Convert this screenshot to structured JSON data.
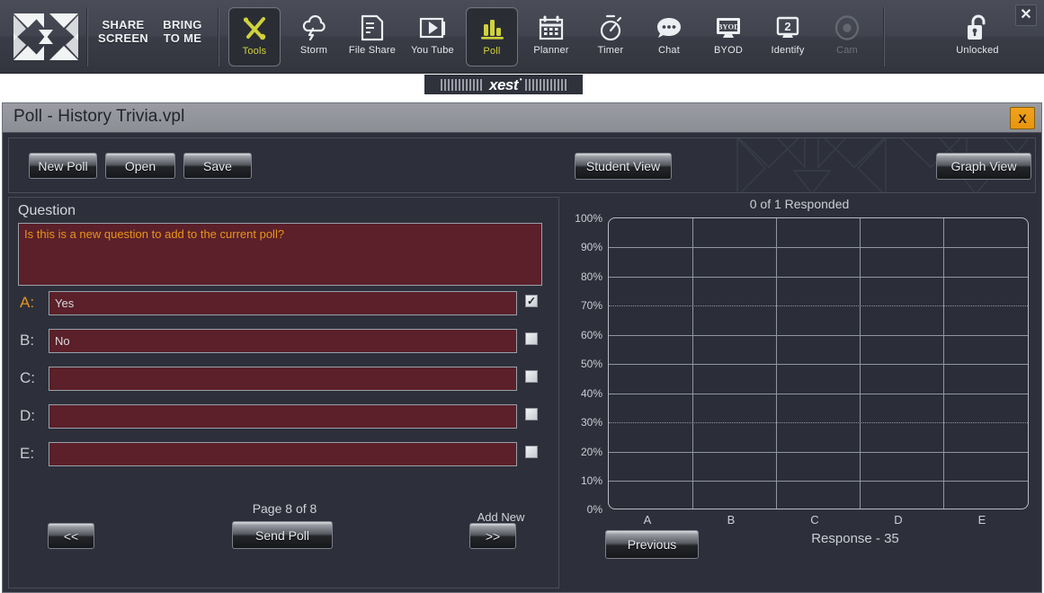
{
  "toolbar": {
    "logo_icon": "xest-x-logo",
    "text_buttons": [
      {
        "name": "share-screen",
        "line1": "SHARE",
        "line2": "SCREEN"
      },
      {
        "name": "bring-to-me",
        "line1": "BRING",
        "line2": "TO ME"
      }
    ],
    "items": [
      {
        "label": "Tools",
        "icon": "tools-wrench-screwdriver-icon",
        "selected": true,
        "dimmed": false
      },
      {
        "label": "Storm",
        "icon": "cloud-lightning-icon",
        "selected": false,
        "dimmed": false
      },
      {
        "label": "File Share",
        "icon": "document-icon",
        "selected": false,
        "dimmed": false
      },
      {
        "label": "You Tube",
        "icon": "video-play-icon",
        "selected": false,
        "dimmed": false
      },
      {
        "label": "Poll",
        "icon": "bar-chart-icon",
        "selected": true,
        "dimmed": false
      },
      {
        "label": "Planner",
        "icon": "calendar-icon",
        "selected": false,
        "dimmed": false
      },
      {
        "label": "Timer",
        "icon": "stopwatch-icon",
        "selected": false,
        "dimmed": false
      },
      {
        "label": "Chat",
        "icon": "speech-bubble-icon",
        "selected": false,
        "dimmed": false
      },
      {
        "label": "BYOD",
        "icon": "monitor-byod-icon",
        "selected": false,
        "dimmed": false
      },
      {
        "label": "Identify",
        "icon": "monitor-number-2-icon",
        "selected": false,
        "dimmed": false
      },
      {
        "label": "Cam",
        "icon": "camera-lens-icon",
        "selected": false,
        "dimmed": true
      }
    ],
    "lock": {
      "label": "Unlocked",
      "icon": "open-padlock-icon"
    },
    "close_label": "✕",
    "badge": {
      "text": "xest",
      "trademark": "•"
    }
  },
  "window": {
    "title": "Poll - History Trivia.vpl",
    "close_label": "X"
  },
  "strip": {
    "new_poll": "New Poll",
    "open": "Open",
    "save": "Save",
    "student_view": "Student View",
    "graph_view": "Graph View"
  },
  "editor": {
    "question_label": "Question",
    "question_text": "Is this is a new question to add to the current poll?",
    "answers": [
      {
        "key": "A:",
        "value": "Yes",
        "checked": true,
        "active": true
      },
      {
        "key": "B:",
        "value": "No",
        "checked": false,
        "active": false
      },
      {
        "key": "C:",
        "value": "",
        "checked": false,
        "active": false
      },
      {
        "key": "D:",
        "value": "",
        "checked": false,
        "active": false
      },
      {
        "key": "E:",
        "value": "",
        "checked": false,
        "active": false
      }
    ],
    "page_info": "Page 8 of 8",
    "add_new_label": "Add New",
    "prev_page_btn": "<<",
    "next_page_btn": ">>",
    "send_poll_btn": "Send Poll"
  },
  "results": {
    "previous_btn": "Previous",
    "response_note": "Response - 35"
  },
  "colors": {
    "accent_yellow": "#cfd23a",
    "field_maroon": "#5b2029",
    "field_text_orange": "#e8941a",
    "close_orange": "#f0a21c",
    "panel_bg": "#2d303a"
  },
  "chart_data": {
    "type": "bar",
    "title": "0 of 1 Responded",
    "categories": [
      "A",
      "B",
      "C",
      "D",
      "E"
    ],
    "values": [
      0,
      0,
      0,
      0,
      0
    ],
    "xlabel": "",
    "ylabel": "",
    "ylim": [
      0,
      100
    ],
    "ytick_labels": [
      "100%",
      "90%",
      "80%",
      "70%",
      "60%",
      "50%",
      "40%",
      "30%",
      "20%",
      "10%",
      "0%"
    ],
    "ytick_values": [
      100,
      90,
      80,
      70,
      60,
      50,
      40,
      30,
      20,
      10,
      0
    ],
    "grid": true,
    "legend": "none",
    "annotation": "Response - 35"
  }
}
